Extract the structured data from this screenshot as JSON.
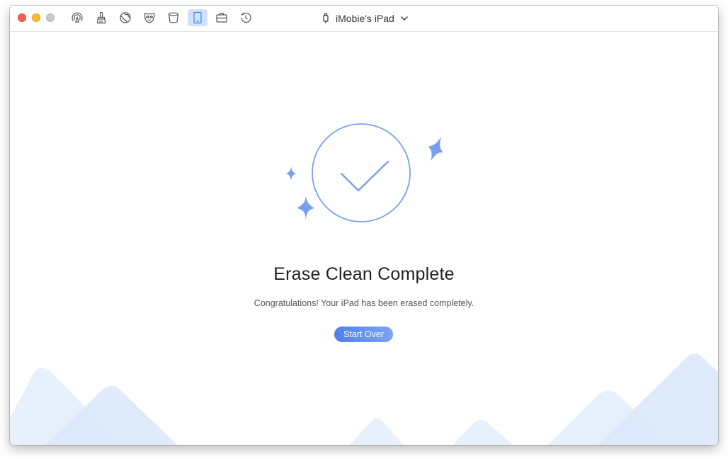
{
  "window": {
    "controls": [
      "close",
      "minimize",
      "maximize"
    ]
  },
  "toolbar": {
    "icons": [
      {
        "name": "airbackup-icon"
      },
      {
        "name": "cleaner-icon"
      },
      {
        "name": "internet-cleanup-icon"
      },
      {
        "name": "privacy-cleanup-icon"
      },
      {
        "name": "system-junk-icon"
      },
      {
        "name": "erase-device-icon",
        "active": true
      },
      {
        "name": "toolkit-icon"
      },
      {
        "name": "history-icon"
      }
    ],
    "active_color": "#cfe2fb"
  },
  "device": {
    "name": "iMobie's iPad"
  },
  "main": {
    "title": "Erase Clean Complete",
    "subtitle": "Congratulations! Your iPad has been erased completely.",
    "start_over_label": "Start Over"
  },
  "colors": {
    "accent": "#4f80e8",
    "illustration": "#7a9ff0",
    "mountain": "#dce8fb"
  }
}
